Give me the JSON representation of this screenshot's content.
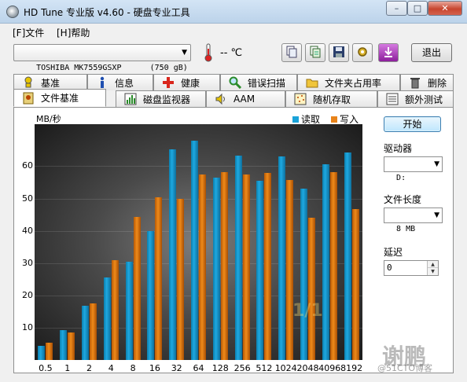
{
  "window": {
    "title": "HD Tune 专业版 v4.60 - 硬盘专业工具",
    "buttons": {
      "minimize": "–",
      "maximize": "□",
      "close": "✕"
    }
  },
  "menu": {
    "file": "[F]文件",
    "help": "[H]帮助"
  },
  "toolbar": {
    "drive": "TOSHIBA MK7559GSXP      (750 gB)",
    "temperature": "-- ℃",
    "exit_label": "退出",
    "icons": [
      "copy-icon",
      "copy-text-icon",
      "save-icon",
      "settings-icon",
      "download-icon"
    ]
  },
  "tabs_row1": [
    {
      "label": "基准",
      "icon": "benchmark-icon"
    },
    {
      "label": "信息",
      "icon": "info-icon"
    },
    {
      "label": "健康",
      "icon": "health-icon"
    },
    {
      "label": "错误扫描",
      "icon": "error-scan-icon"
    },
    {
      "label": "文件夹占用率",
      "icon": "folder-usage-icon"
    },
    {
      "label": "删除",
      "icon": "erase-icon"
    }
  ],
  "tabs_row2": [
    {
      "label": "文件基准",
      "icon": "file-benchmark-icon",
      "active": true
    },
    {
      "label": "磁盘监视器",
      "icon": "disk-monitor-icon"
    },
    {
      "label": "AAM",
      "icon": "aam-icon"
    },
    {
      "label": "随机存取",
      "icon": "random-access-icon"
    },
    {
      "label": "额外测试",
      "icon": "extra-tests-icon"
    }
  ],
  "controls": {
    "start_label": "开始",
    "drive_label": "驱动器",
    "drive_value": "D:",
    "file_length_label": "文件长度",
    "file_length_value": "8 MB",
    "delay_label": "延迟",
    "delay_value": "0"
  },
  "watermark": {
    "brand": "谢鹏",
    "site": "@51CTO博客"
  },
  "chart_data": {
    "type": "bar",
    "ylabel": "MB/秒",
    "ylim": [
      0,
      73
    ],
    "yticks": [
      10,
      20,
      30,
      40,
      50,
      60
    ],
    "categories": [
      "0.5",
      "1",
      "2",
      "4",
      "8",
      "16",
      "32",
      "64",
      "128",
      "256",
      "512",
      "1024",
      "2048",
      "4096",
      "8192"
    ],
    "series": [
      {
        "name": "读取",
        "color": "#1aa3d9",
        "values": [
          4.3,
          9.3,
          16.9,
          25.5,
          30.5,
          40.0,
          65.2,
          67.8,
          56.4,
          63.2,
          55.4,
          63.1,
          53.1,
          60.5,
          64.2
        ]
      },
      {
        "name": "写入",
        "color": "#e8831a",
        "values": [
          5.4,
          8.4,
          17.5,
          30.8,
          44.3,
          50.3,
          50.0,
          57.4,
          58.2,
          57.5,
          58.0,
          55.8,
          44.0,
          58.1,
          46.6
        ]
      }
    ],
    "legend_position": "top-right",
    "grid": true
  }
}
